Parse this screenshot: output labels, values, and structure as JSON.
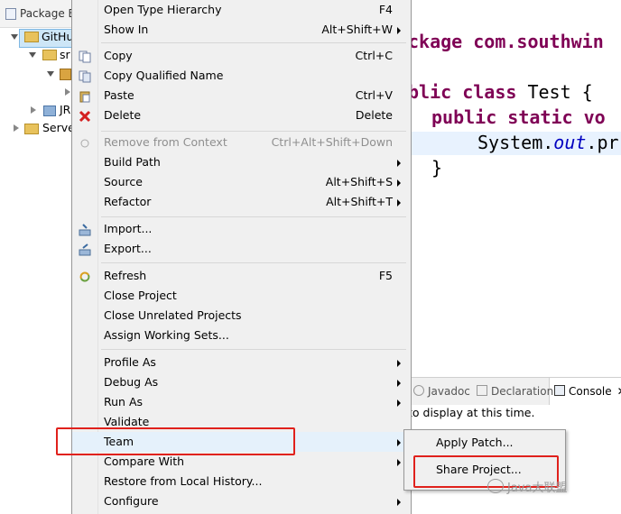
{
  "package_explorer": {
    "tab_title": "Package Ex",
    "rows": [
      "GitHu",
      "sr",
      "JR",
      "Serve"
    ]
  },
  "editor": {
    "line1": "ckage com.southwin",
    "line2_kw": "blic class",
    "line2_rest": " Test {",
    "line3_kw": "public static vo",
    "line4_a": "System.",
    "line4_b": "out",
    "line4_c": ".pr",
    "line5": "}"
  },
  "views": {
    "tabs": [
      "Javadoc",
      "Declaration",
      "Console"
    ],
    "active_tab": "Console",
    "body_text": "to display at this time."
  },
  "menu": {
    "items": [
      {
        "label": "Open Type Hierarchy",
        "accel": "F4",
        "arrow": false,
        "disabled": false,
        "icon": ""
      },
      {
        "label": "Show In",
        "accel": "Alt+Shift+W",
        "arrow": true,
        "disabled": false,
        "icon": ""
      },
      {
        "label": "Copy",
        "accel": "Ctrl+C",
        "arrow": false,
        "disabled": false,
        "icon": "copy-icon"
      },
      {
        "label": "Copy Qualified Name",
        "accel": "",
        "arrow": false,
        "disabled": false,
        "icon": "copy-qualified-icon"
      },
      {
        "label": "Paste",
        "accel": "Ctrl+V",
        "arrow": false,
        "disabled": false,
        "icon": "paste-icon"
      },
      {
        "label": "Delete",
        "accel": "Delete",
        "arrow": false,
        "disabled": false,
        "icon": "delete-icon"
      },
      {
        "label": "Remove from Context",
        "accel": "Ctrl+Alt+Shift+Down",
        "arrow": false,
        "disabled": true,
        "icon": "remove-context-icon"
      },
      {
        "label": "Build Path",
        "accel": "",
        "arrow": true,
        "disabled": false,
        "icon": ""
      },
      {
        "label": "Source",
        "accel": "Alt+Shift+S",
        "arrow": true,
        "disabled": false,
        "icon": ""
      },
      {
        "label": "Refactor",
        "accel": "Alt+Shift+T",
        "arrow": true,
        "disabled": false,
        "icon": ""
      },
      {
        "label": "Import...",
        "accel": "",
        "arrow": false,
        "disabled": false,
        "icon": "import-icon"
      },
      {
        "label": "Export...",
        "accel": "",
        "arrow": false,
        "disabled": false,
        "icon": "export-icon"
      },
      {
        "label": "Refresh",
        "accel": "F5",
        "arrow": false,
        "disabled": false,
        "icon": "refresh-icon"
      },
      {
        "label": "Close Project",
        "accel": "",
        "arrow": false,
        "disabled": false,
        "icon": ""
      },
      {
        "label": "Close Unrelated Projects",
        "accel": "",
        "arrow": false,
        "disabled": false,
        "icon": ""
      },
      {
        "label": "Assign Working Sets...",
        "accel": "",
        "arrow": false,
        "disabled": false,
        "icon": ""
      },
      {
        "label": "Profile As",
        "accel": "",
        "arrow": true,
        "disabled": false,
        "icon": ""
      },
      {
        "label": "Debug As",
        "accel": "",
        "arrow": true,
        "disabled": false,
        "icon": ""
      },
      {
        "label": "Run As",
        "accel": "",
        "arrow": true,
        "disabled": false,
        "icon": ""
      },
      {
        "label": "Validate",
        "accel": "",
        "arrow": false,
        "disabled": false,
        "icon": ""
      },
      {
        "label": "Team",
        "accel": "",
        "arrow": true,
        "disabled": false,
        "icon": "",
        "highlighted": true
      },
      {
        "label": "Compare With",
        "accel": "",
        "arrow": true,
        "disabled": false,
        "icon": ""
      },
      {
        "label": "Restore from Local History...",
        "accel": "",
        "arrow": false,
        "disabled": false,
        "icon": ""
      },
      {
        "label": "Configure",
        "accel": "",
        "arrow": true,
        "disabled": false,
        "icon": ""
      }
    ]
  },
  "team_submenu": {
    "items": [
      "Apply Patch...",
      "Share Project..."
    ]
  },
  "watermark": "Java大联盟",
  "colors": {
    "keyword": "#7f0055",
    "field": "#0000c0",
    "highlight": "#e5f1fb",
    "annotation_red": "#e0211c"
  }
}
